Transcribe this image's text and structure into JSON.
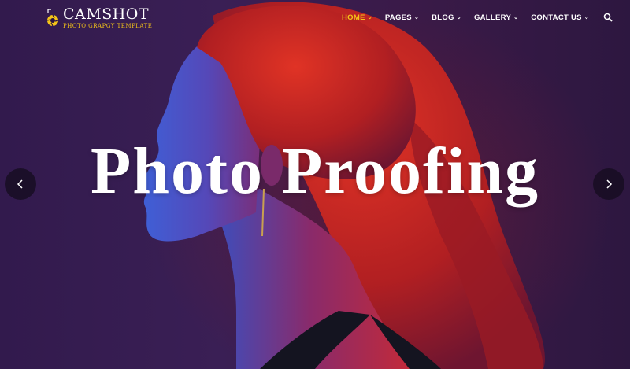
{
  "brand": {
    "name": "CAMSHOT",
    "tagline": "PHOTO GRAPGY TEMPLATE"
  },
  "nav": {
    "items": [
      {
        "label": "HOME",
        "active": true
      },
      {
        "label": "PAGES",
        "active": false
      },
      {
        "label": "BLOG",
        "active": false
      },
      {
        "label": "GALLERY",
        "active": false
      },
      {
        "label": "CONTACT US",
        "active": false
      }
    ],
    "search_icon": "search-icon",
    "chevron_icon": "chevron-down-icon"
  },
  "hero": {
    "headline": "Photo Proofing",
    "prev_icon": "chevron-left-icon",
    "next_icon": "chevron-right-icon"
  },
  "colors": {
    "accent": "#f5c518",
    "background": "#3a1f55",
    "hair": "#c8281e",
    "skin_light": "#4a6ad8"
  }
}
